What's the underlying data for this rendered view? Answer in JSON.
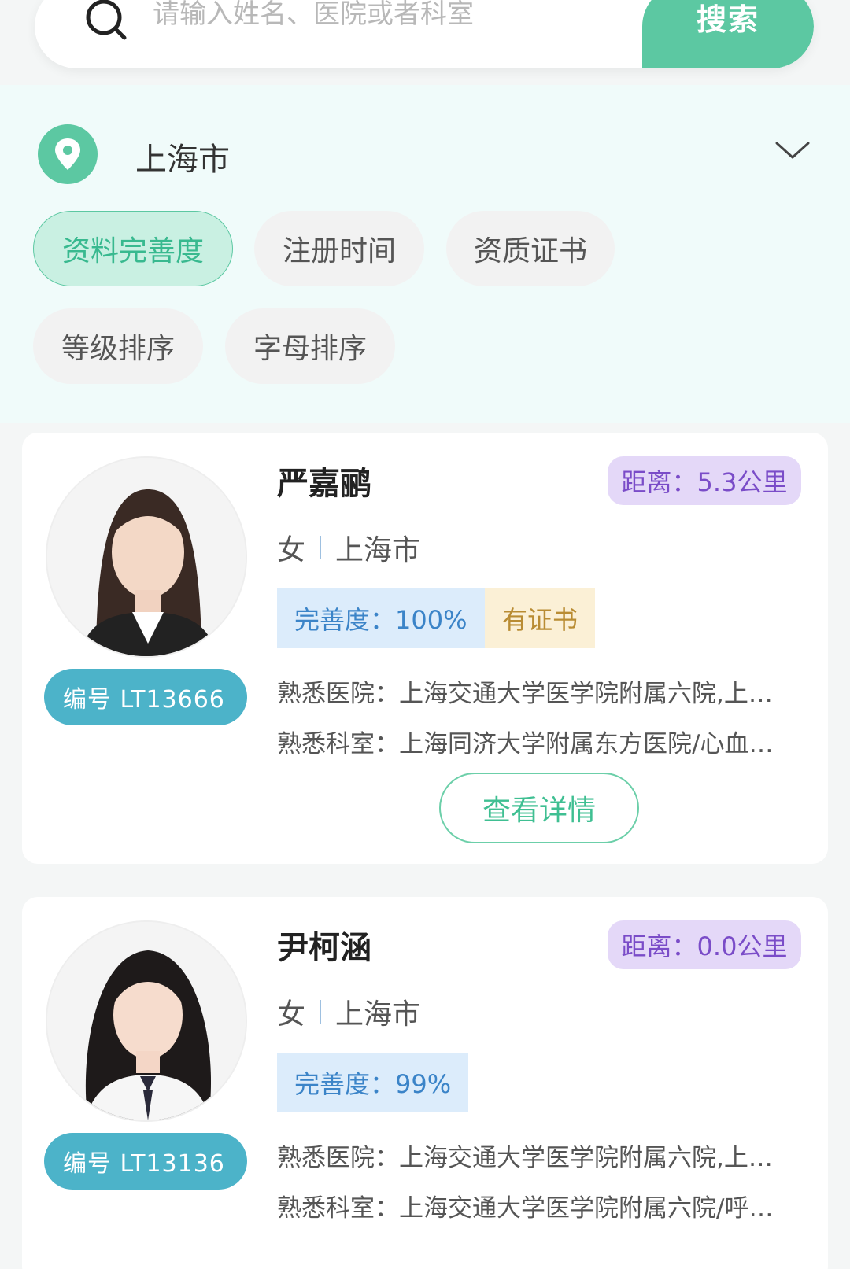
{
  "search": {
    "placeholder": "请输入姓名、医院或者科室",
    "button_label": "搜索"
  },
  "location": {
    "city": "上海市"
  },
  "filters": [
    {
      "label": "资料完善度",
      "active": true
    },
    {
      "label": "注册时间",
      "active": false
    },
    {
      "label": "资质证书",
      "active": false
    },
    {
      "label": "等级排序",
      "active": false
    },
    {
      "label": "字母排序",
      "active": false
    }
  ],
  "cards": [
    {
      "name": "严嘉鹂",
      "distance": "距离：5.3公里",
      "gender": "女",
      "city": "上海市",
      "completeness": "完善度：100%",
      "certificate": "有证书",
      "id": "编号 LT13666",
      "hospital": "熟悉医院：上海交通大学医学院附属六院,上…",
      "department": "熟悉科室：上海同济大学附属东方医院/心血…",
      "detail_label": "查看详情"
    },
    {
      "name": "尹柯涵",
      "distance": "距离：0.0公里",
      "gender": "女",
      "city": "上海市",
      "completeness": "完善度：99%",
      "certificate": "",
      "id": "编号 LT13136",
      "hospital": "熟悉医院：上海交通大学医学院附属六院,上…",
      "department": "熟悉科室：上海交通大学医学院附属六院/呼…",
      "detail_label": ""
    }
  ],
  "colors": {
    "accent": "#5cc8a2",
    "badge": "#4cb3c9",
    "distance_bg": "#e4d8f8",
    "distance_text": "#7a4cc8",
    "complete_bg": "#dcecfb",
    "complete_text": "#3b84c8",
    "cert_bg": "#fbf0d6",
    "cert_text": "#b98c33"
  }
}
